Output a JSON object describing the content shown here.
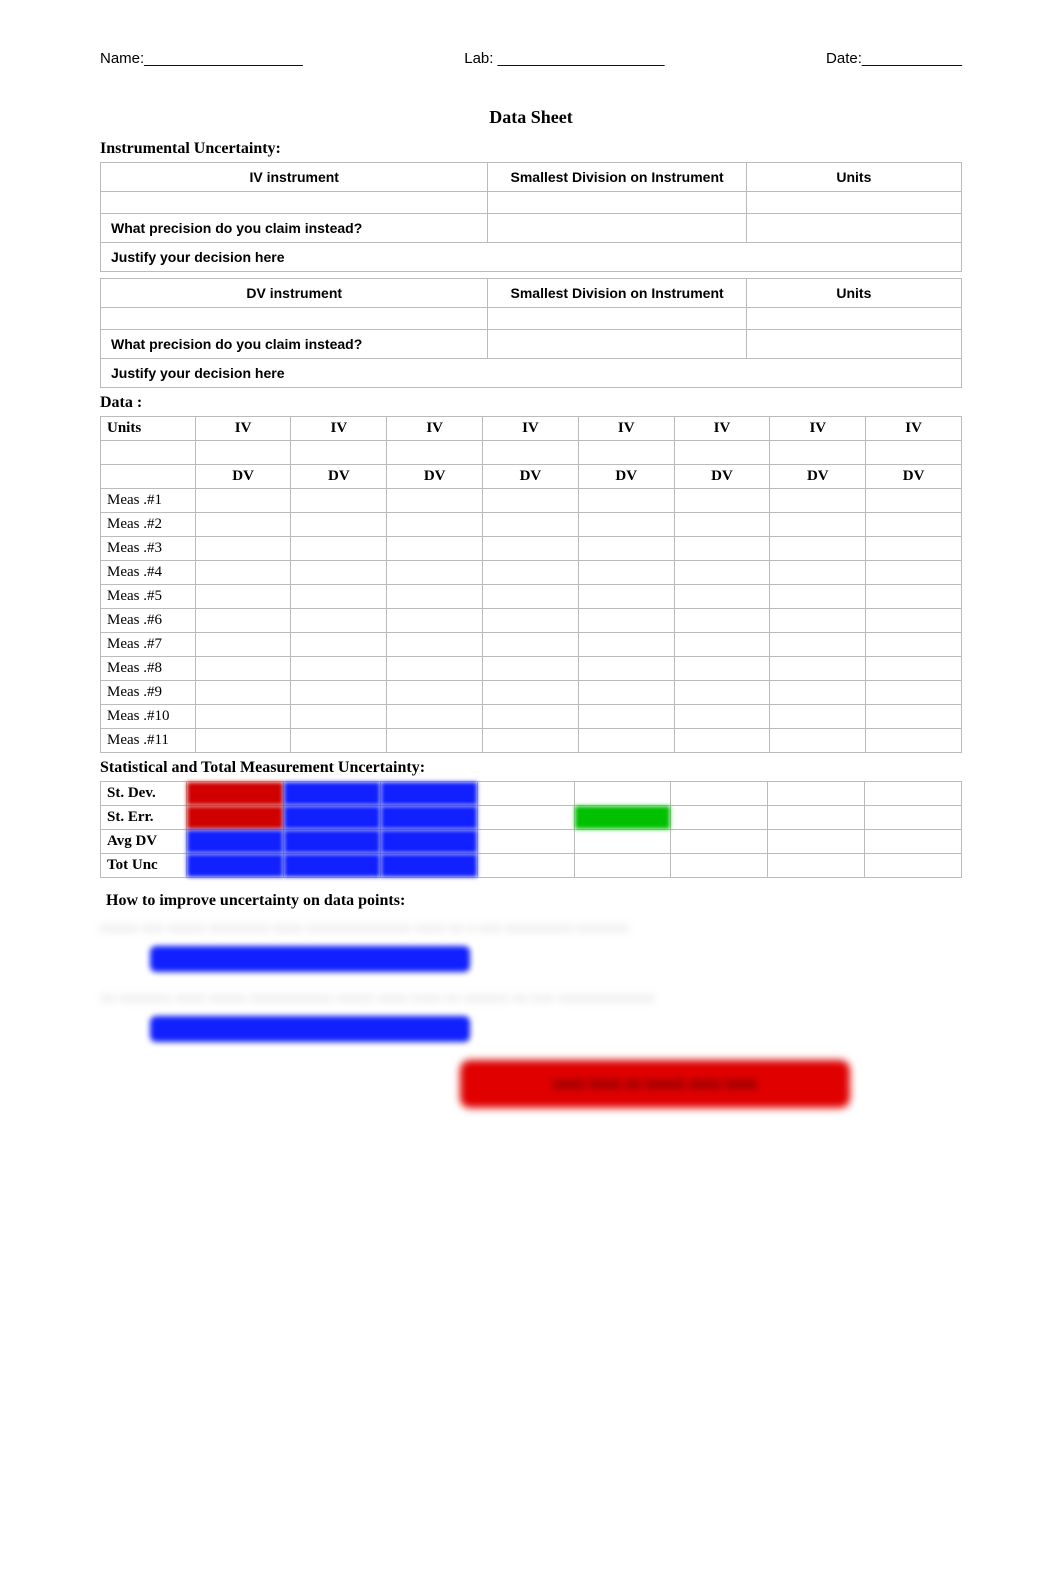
{
  "header": {
    "name_label": "Name:___________________",
    "lab_label": "Lab: ____________________",
    "date_label": "Date:____________"
  },
  "page_title": "Data Sheet",
  "sections": {
    "instrumental": "Instrumental Uncertainty:",
    "data": "Data :",
    "stats": "Statistical and Total Measurement Uncertainty:",
    "improve": "How to improve uncertainty on data points:"
  },
  "inst": {
    "iv_instrument": "IV instrument",
    "dv_instrument": "DV instrument",
    "smallest_div": "Smallest Division on Instrument",
    "units": "Units",
    "precision_q": "What precision do you claim instead?",
    "justify": "Justify your decision here"
  },
  "data_table": {
    "units_hdr": "Units",
    "iv": "IV",
    "dv": "DV",
    "rows": [
      "Meas .#1",
      "Meas .#2",
      "Meas .#3",
      "Meas .#4",
      "Meas .#5",
      "Meas .#6",
      "Meas .#7",
      "Meas .#8",
      "Meas .#9",
      "Meas .#10",
      "Meas .#11"
    ]
  },
  "stats": {
    "stdev": "St. Dev.",
    "sterr": "St. Err.",
    "avgdv": "Avg DV",
    "totunc": "Tot Unc"
  }
}
